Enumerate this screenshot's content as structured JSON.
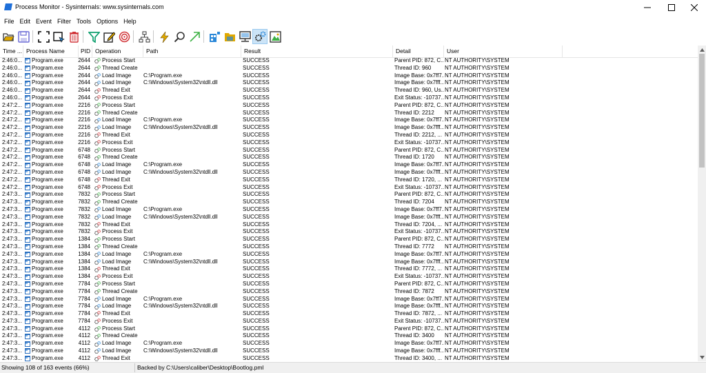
{
  "window": {
    "title": "Process Monitor - Sysinternals: www.sysinternals.com"
  },
  "menu": [
    "File",
    "Edit",
    "Event",
    "Filter",
    "Tools",
    "Options",
    "Help"
  ],
  "toolbar": [
    {
      "name": "open-icon",
      "color": "#e0a800"
    },
    {
      "name": "save-icon",
      "color": "#6b6bd6"
    },
    {
      "name": "separator"
    },
    {
      "name": "autoscroll-icon",
      "color": "#000000"
    },
    {
      "name": "capture-icon",
      "color": "#000000"
    },
    {
      "name": "clear-icon",
      "color": "#d13438"
    },
    {
      "name": "separator"
    },
    {
      "name": "filter-icon",
      "color": "#0e9f6e"
    },
    {
      "name": "highlight-icon",
      "color": "#222222"
    },
    {
      "name": "include-process-icon",
      "color": "#d13438"
    },
    {
      "name": "separator"
    },
    {
      "name": "process-tree-icon",
      "color": "#333333"
    },
    {
      "name": "separator"
    },
    {
      "name": "jump-icon",
      "color": "#e0a800"
    },
    {
      "name": "find-icon",
      "color": "#333333"
    },
    {
      "name": "jump-to-icon",
      "color": "#3cb043"
    },
    {
      "name": "separator"
    },
    {
      "name": "registry-activity-icon",
      "color": "#2b88d8"
    },
    {
      "name": "file-activity-icon",
      "color": "#e0a800"
    },
    {
      "name": "network-activity-icon",
      "color": "#333333"
    },
    {
      "name": "process-activity-icon",
      "color": "#2b88d8",
      "active": true
    },
    {
      "name": "profiling-activity-icon",
      "color": "#3cb043"
    }
  ],
  "columns": [
    "Time ...",
    "Process Name",
    "PID",
    "Operation",
    "Path",
    "Result",
    "Detail",
    "User"
  ],
  "rows": [
    [
      "2:46:0...",
      "Program.exe",
      "2644",
      "Process Start",
      "",
      "SUCCESS",
      "Parent PID: 872, C...",
      "NT AUTHORITY\\SYSTEM"
    ],
    [
      "2:46:0...",
      "Program.exe",
      "2644",
      "Thread Create",
      "",
      "SUCCESS",
      "Thread ID: 960",
      "NT AUTHORITY\\SYSTEM"
    ],
    [
      "2:46:0...",
      "Program.exe",
      "2644",
      "Load Image",
      "C:\\Program.exe",
      "SUCCESS",
      "Image Base: 0x7ff7...",
      "NT AUTHORITY\\SYSTEM"
    ],
    [
      "2:46:0...",
      "Program.exe",
      "2644",
      "Load Image",
      "C:\\Windows\\System32\\ntdll.dll",
      "SUCCESS",
      "Image Base: 0x7fff...",
      "NT AUTHORITY\\SYSTEM"
    ],
    [
      "2:46:0...",
      "Program.exe",
      "2644",
      "Thread Exit",
      "",
      "SUCCESS",
      "Thread ID: 960, Us...",
      "NT AUTHORITY\\SYSTEM"
    ],
    [
      "2:46:0...",
      "Program.exe",
      "2644",
      "Process Exit",
      "",
      "SUCCESS",
      "Exit Status: -10737...",
      "NT AUTHORITY\\SYSTEM"
    ],
    [
      "2:47:2...",
      "Program.exe",
      "2216",
      "Process Start",
      "",
      "SUCCESS",
      "Parent PID: 872, C...",
      "NT AUTHORITY\\SYSTEM"
    ],
    [
      "2:47:2...",
      "Program.exe",
      "2216",
      "Thread Create",
      "",
      "SUCCESS",
      "Thread ID: 2212",
      "NT AUTHORITY\\SYSTEM"
    ],
    [
      "2:47:2...",
      "Program.exe",
      "2216",
      "Load Image",
      "C:\\Program.exe",
      "SUCCESS",
      "Image Base: 0x7ff7...",
      "NT AUTHORITY\\SYSTEM"
    ],
    [
      "2:47:2...",
      "Program.exe",
      "2216",
      "Load Image",
      "C:\\Windows\\System32\\ntdll.dll",
      "SUCCESS",
      "Image Base: 0x7fff...",
      "NT AUTHORITY\\SYSTEM"
    ],
    [
      "2:47:2...",
      "Program.exe",
      "2216",
      "Thread Exit",
      "",
      "SUCCESS",
      "Thread ID: 2212, ...",
      "NT AUTHORITY\\SYSTEM"
    ],
    [
      "2:47:2...",
      "Program.exe",
      "2216",
      "Process Exit",
      "",
      "SUCCESS",
      "Exit Status: -10737...",
      "NT AUTHORITY\\SYSTEM"
    ],
    [
      "2:47:2...",
      "Program.exe",
      "6748",
      "Process Start",
      "",
      "SUCCESS",
      "Parent PID: 872, C...",
      "NT AUTHORITY\\SYSTEM"
    ],
    [
      "2:47:2...",
      "Program.exe",
      "6748",
      "Thread Create",
      "",
      "SUCCESS",
      "Thread ID: 1720",
      "NT AUTHORITY\\SYSTEM"
    ],
    [
      "2:47:2...",
      "Program.exe",
      "6748",
      "Load Image",
      "C:\\Program.exe",
      "SUCCESS",
      "Image Base: 0x7ff7...",
      "NT AUTHORITY\\SYSTEM"
    ],
    [
      "2:47:2...",
      "Program.exe",
      "6748",
      "Load Image",
      "C:\\Windows\\System32\\ntdll.dll",
      "SUCCESS",
      "Image Base: 0x7fff...",
      "NT AUTHORITY\\SYSTEM"
    ],
    [
      "2:47:2...",
      "Program.exe",
      "6748",
      "Thread Exit",
      "",
      "SUCCESS",
      "Thread ID: 1720, ...",
      "NT AUTHORITY\\SYSTEM"
    ],
    [
      "2:47:2...",
      "Program.exe",
      "6748",
      "Process Exit",
      "",
      "SUCCESS",
      "Exit Status: -10737...",
      "NT AUTHORITY\\SYSTEM"
    ],
    [
      "2:47:3...",
      "Program.exe",
      "7832",
      "Process Start",
      "",
      "SUCCESS",
      "Parent PID: 872, C...",
      "NT AUTHORITY\\SYSTEM"
    ],
    [
      "2:47:3...",
      "Program.exe",
      "7832",
      "Thread Create",
      "",
      "SUCCESS",
      "Thread ID: 7204",
      "NT AUTHORITY\\SYSTEM"
    ],
    [
      "2:47:3...",
      "Program.exe",
      "7832",
      "Load Image",
      "C:\\Program.exe",
      "SUCCESS",
      "Image Base: 0x7ff7...",
      "NT AUTHORITY\\SYSTEM"
    ],
    [
      "2:47:3...",
      "Program.exe",
      "7832",
      "Load Image",
      "C:\\Windows\\System32\\ntdll.dll",
      "SUCCESS",
      "Image Base: 0x7fff...",
      "NT AUTHORITY\\SYSTEM"
    ],
    [
      "2:47:3...",
      "Program.exe",
      "7832",
      "Thread Exit",
      "",
      "SUCCESS",
      "Thread ID: 7204, ...",
      "NT AUTHORITY\\SYSTEM"
    ],
    [
      "2:47:3...",
      "Program.exe",
      "7832",
      "Process Exit",
      "",
      "SUCCESS",
      "Exit Status: -10737...",
      "NT AUTHORITY\\SYSTEM"
    ],
    [
      "2:47:3...",
      "Program.exe",
      "1384",
      "Process Start",
      "",
      "SUCCESS",
      "Parent PID: 872, C...",
      "NT AUTHORITY\\SYSTEM"
    ],
    [
      "2:47:3...",
      "Program.exe",
      "1384",
      "Thread Create",
      "",
      "SUCCESS",
      "Thread ID: 7772",
      "NT AUTHORITY\\SYSTEM"
    ],
    [
      "2:47:3...",
      "Program.exe",
      "1384",
      "Load Image",
      "C:\\Program.exe",
      "SUCCESS",
      "Image Base: 0x7ff7...",
      "NT AUTHORITY\\SYSTEM"
    ],
    [
      "2:47:3...",
      "Program.exe",
      "1384",
      "Load Image",
      "C:\\Windows\\System32\\ntdll.dll",
      "SUCCESS",
      "Image Base: 0x7fff...",
      "NT AUTHORITY\\SYSTEM"
    ],
    [
      "2:47:3...",
      "Program.exe",
      "1384",
      "Thread Exit",
      "",
      "SUCCESS",
      "Thread ID: 7772, ...",
      "NT AUTHORITY\\SYSTEM"
    ],
    [
      "2:47:3...",
      "Program.exe",
      "1384",
      "Process Exit",
      "",
      "SUCCESS",
      "Exit Status: -10737...",
      "NT AUTHORITY\\SYSTEM"
    ],
    [
      "2:47:3...",
      "Program.exe",
      "7784",
      "Process Start",
      "",
      "SUCCESS",
      "Parent PID: 872, C...",
      "NT AUTHORITY\\SYSTEM"
    ],
    [
      "2:47:3...",
      "Program.exe",
      "7784",
      "Thread Create",
      "",
      "SUCCESS",
      "Thread ID: 7872",
      "NT AUTHORITY\\SYSTEM"
    ],
    [
      "2:47:3...",
      "Program.exe",
      "7784",
      "Load Image",
      "C:\\Program.exe",
      "SUCCESS",
      "Image Base: 0x7ff7...",
      "NT AUTHORITY\\SYSTEM"
    ],
    [
      "2:47:3...",
      "Program.exe",
      "7784",
      "Load Image",
      "C:\\Windows\\System32\\ntdll.dll",
      "SUCCESS",
      "Image Base: 0x7fff...",
      "NT AUTHORITY\\SYSTEM"
    ],
    [
      "2:47:3...",
      "Program.exe",
      "7784",
      "Thread Exit",
      "",
      "SUCCESS",
      "Thread ID: 7872, ...",
      "NT AUTHORITY\\SYSTEM"
    ],
    [
      "2:47:3...",
      "Program.exe",
      "7784",
      "Process Exit",
      "",
      "SUCCESS",
      "Exit Status: -10737...",
      "NT AUTHORITY\\SYSTEM"
    ],
    [
      "2:47:3...",
      "Program.exe",
      "4112",
      "Process Start",
      "",
      "SUCCESS",
      "Parent PID: 872, C...",
      "NT AUTHORITY\\SYSTEM"
    ],
    [
      "2:47:3...",
      "Program.exe",
      "4112",
      "Thread Create",
      "",
      "SUCCESS",
      "Thread ID: 3400",
      "NT AUTHORITY\\SYSTEM"
    ],
    [
      "2:47:3...",
      "Program.exe",
      "4112",
      "Load Image",
      "C:\\Program.exe",
      "SUCCESS",
      "Image Base: 0x7ff7...",
      "NT AUTHORITY\\SYSTEM"
    ],
    [
      "2:47:3...",
      "Program.exe",
      "4112",
      "Load Image",
      "C:\\Windows\\System32\\ntdll.dll",
      "SUCCESS",
      "Image Base: 0x7fff...",
      "NT AUTHORITY\\SYSTEM"
    ],
    [
      "2:47:3...",
      "Program.exe",
      "4112",
      "Thread Exit",
      "",
      "SUCCESS",
      "Thread ID: 3400, ...",
      "NT AUTHORITY\\SYSTEM"
    ]
  ],
  "status": {
    "events": "Showing 108 of 163 events (66%)",
    "backing": "Backed by C:\\Users\\caliber\\Desktop\\Bootlog.pml"
  },
  "scroll": {
    "position": 0.0,
    "visible_fraction": 0.38
  }
}
